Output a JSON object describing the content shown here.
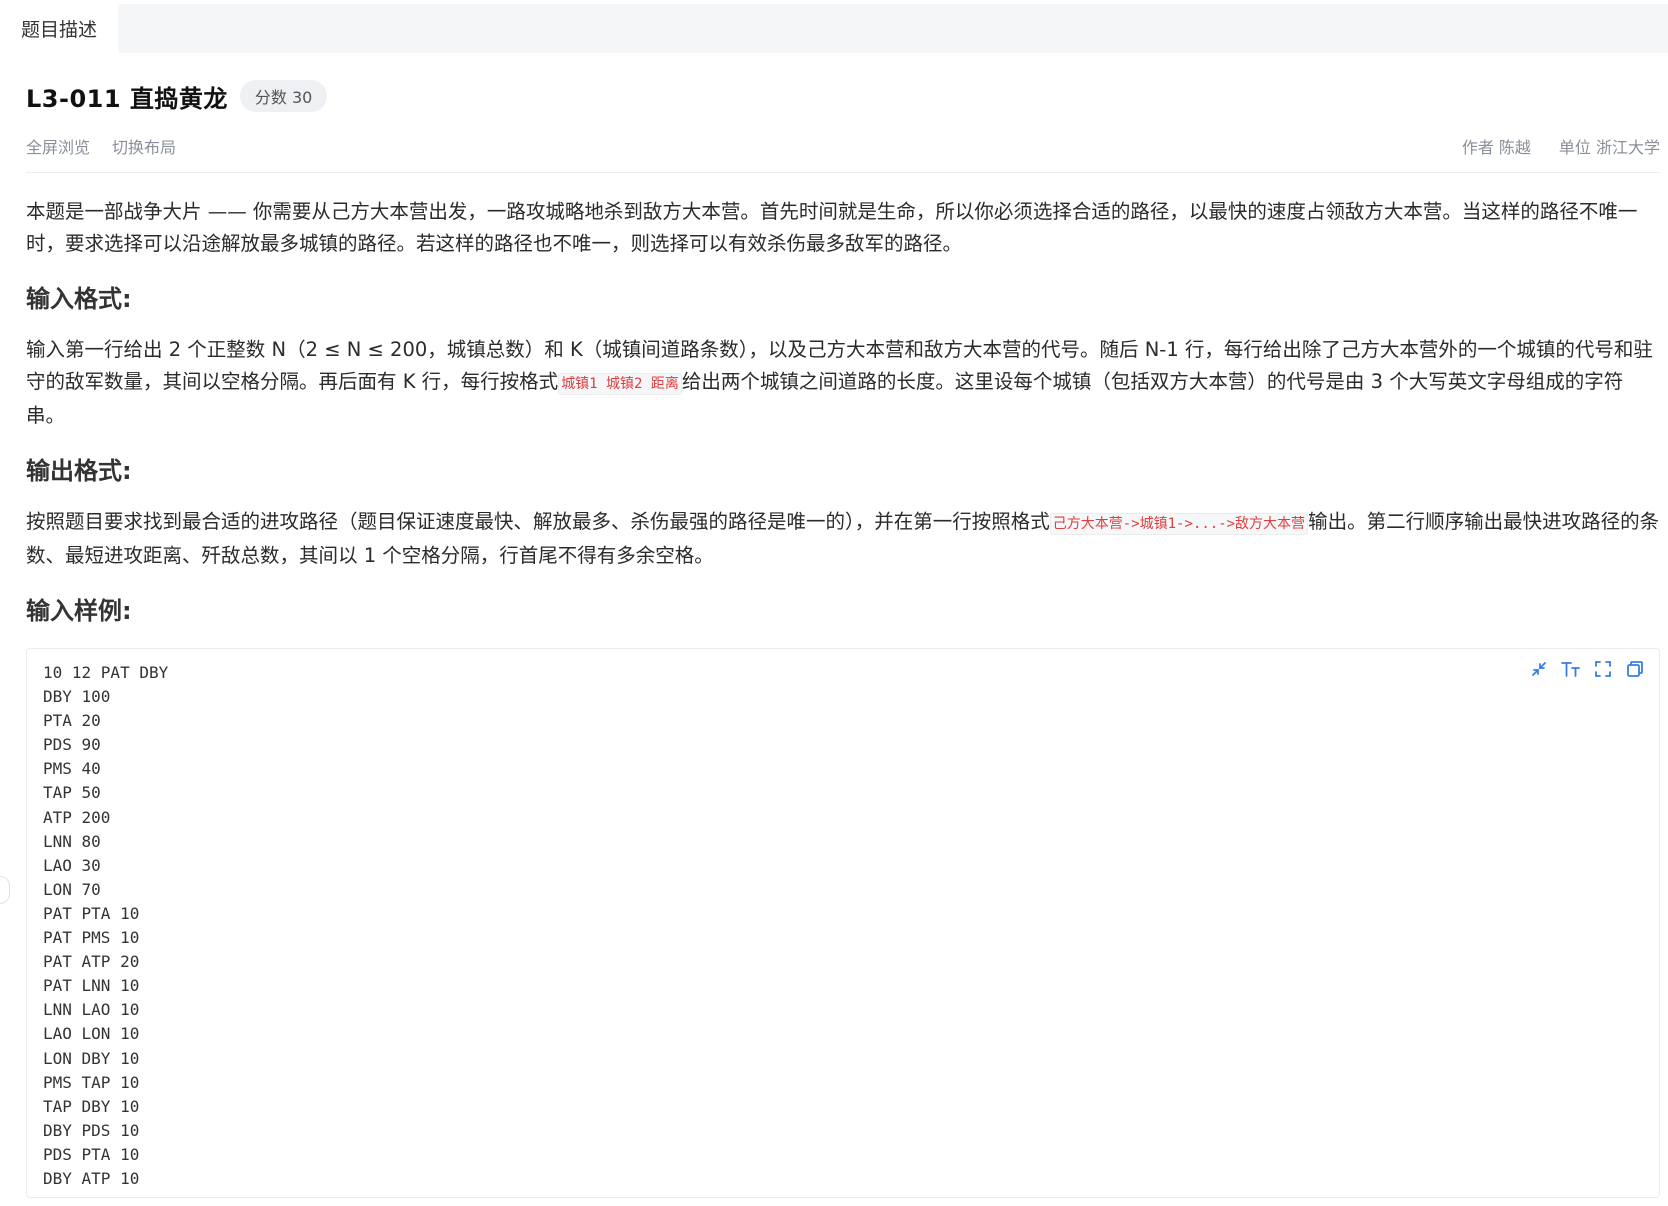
{
  "tabs": [
    {
      "label": "题目描述"
    }
  ],
  "problem": {
    "title": "L3-011 直捣黄龙",
    "score": "分数 30"
  },
  "meta": {
    "actions": [
      "全屏浏览",
      "切换布局"
    ],
    "author": "作者 陈越",
    "org": "单位 浙江大学"
  },
  "description": {
    "p1": "本题是一部战争大片 —— 你需要从己方大本营出发，一路攻城略地杀到敌方大本营。首先时间就是生命，所以你必须选择合适的路径，以最快的速度占领敌方大本营。当这样的路径不唯一时，要求选择可以沿途解放最多城镇的路径。若这样的路径也不唯一，则选择可以有效杀伤最多敌军的路径。"
  },
  "input_format": {
    "heading": "输入格式:",
    "text_a": "输入第一行给出 2 个正整数 N（2 ≤ N ≤ 200，城镇总数）和 K（城镇间道路条数），以及己方大本营和敌方大本营的代号。随后 N-1 行，每行给出除了己方大本营外的一个城镇的代号和驻守的敌军数量，其间以空格分隔。再后面有 K 行，每行按格式",
    "code": "城镇1 城镇2 距离",
    "text_b": "给出两个城镇之间道路的长度。这里设每个城镇（包括双方大本营）的代号是由 3 个大写英文字母组成的字符串。"
  },
  "output_format": {
    "heading": "输出格式:",
    "text_a": "按照题目要求找到最合适的进攻路径（题目保证速度最快、解放最多、杀伤最强的路径是唯一的），并在第一行按照格式",
    "code": "己方大本营->城镇1->...->敌方大本营",
    "text_b": "输出。第二行顺序输出最快进攻路径的条数、最短进攻距离、歼敌总数，其间以 1 个空格分隔，行首尾不得有多余空格。"
  },
  "sample_input": {
    "heading": "输入样例:",
    "lines": [
      "10 12 PAT DBY",
      "DBY 100",
      "PTA 20",
      "PDS 90",
      "PMS 40",
      "TAP 50",
      "ATP 200",
      "LNN 80",
      "LAO 30",
      "LON 70",
      "PAT PTA 10",
      "PAT PMS 10",
      "PAT ATP 20",
      "PAT LNN 10",
      "LNN LAO 10",
      "LAO LON 10",
      "LON DBY 10",
      "PMS TAP 10",
      "TAP DBY 10",
      "DBY PDS 10",
      "PDS PTA 10",
      "DBY ATP 10"
    ]
  },
  "code_tools": [
    "collapse-icon",
    "font-size-icon",
    "fullscreen-icon",
    "copy-icon"
  ],
  "colors": {
    "accent": "#3a7be8",
    "inline_code": "#e03e3e"
  }
}
